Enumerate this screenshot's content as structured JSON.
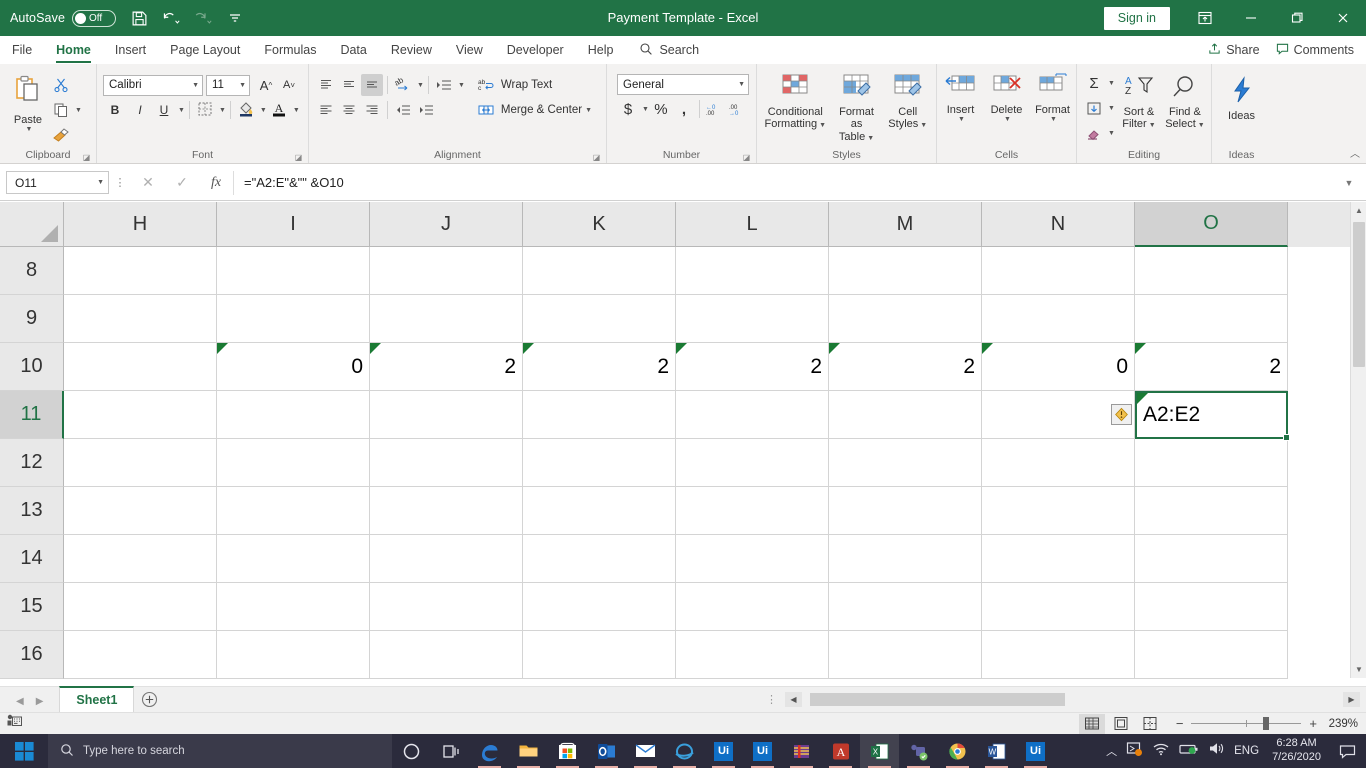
{
  "titlebar": {
    "autosave_label": "AutoSave",
    "autosave_state": "Off",
    "title": "Payment Template  -  Excel",
    "signin_label": "Sign in",
    "qat": [
      {
        "name": "save-icon",
        "label": "Save"
      },
      {
        "name": "undo-icon",
        "label": "Undo"
      },
      {
        "name": "redo-icon",
        "label": "Redo"
      },
      {
        "name": "customize-quick-access-toolbar-icon",
        "label": "Customize Quick Access Toolbar"
      }
    ],
    "window_buttons": [
      {
        "name": "ribbon-display-options-icon",
        "label": "Ribbon Display Options"
      },
      {
        "name": "minimize-icon",
        "label": "Minimize"
      },
      {
        "name": "restore-icon",
        "label": "Restore Down"
      },
      {
        "name": "close-icon",
        "label": "Close"
      }
    ],
    "accent_color": "#217346"
  },
  "tabs": [
    {
      "label": "File",
      "active": false
    },
    {
      "label": "Home",
      "active": true
    },
    {
      "label": "Insert",
      "active": false
    },
    {
      "label": "Page Layout",
      "active": false
    },
    {
      "label": "Formulas",
      "active": false
    },
    {
      "label": "Data",
      "active": false
    },
    {
      "label": "Review",
      "active": false
    },
    {
      "label": "View",
      "active": false
    },
    {
      "label": "Developer",
      "active": false
    },
    {
      "label": "Help",
      "active": false
    }
  ],
  "search": {
    "label": "Search"
  },
  "tabstrip_right": [
    {
      "label": "Share",
      "icon": "share-icon"
    },
    {
      "label": "Comments",
      "icon": "comments-icon"
    }
  ],
  "ribbon": {
    "clipboard": {
      "group_label": "Clipboard",
      "paste_label": "Paste",
      "cut_label": "Cut",
      "copy_label": "Copy",
      "format_painter_label": "Format Painter"
    },
    "font": {
      "group_label": "Font",
      "font_name": "Calibri",
      "font_size": "11",
      "grow_label": "A",
      "shrink_label": "A",
      "bold_label": "B",
      "italic_label": "I",
      "underline_label": "U",
      "borders_label": "Borders",
      "fill_color_label": "Fill Color",
      "font_color_label": "Font Color"
    },
    "alignment": {
      "group_label": "Alignment",
      "wrap_text_label": "Wrap Text",
      "merge_center_label": "Merge & Center",
      "orientation_label": "Orientation",
      "indent_label": "Indent"
    },
    "number": {
      "group_label": "Number",
      "format": "General",
      "currency_label": "$",
      "percent_label": "%",
      "comma_label": ",",
      "increase_decimal_label": "Increase Decimal",
      "decrease_decimal_label": "Decrease Decimal"
    },
    "styles": {
      "group_label": "Styles",
      "items": [
        {
          "line1": "Conditional",
          "line2": "Formatting"
        },
        {
          "line1": "Format as",
          "line2": "Table"
        },
        {
          "line1": "Cell",
          "line2": "Styles"
        }
      ]
    },
    "cells": {
      "group_label": "Cells",
      "items": [
        {
          "label": "Insert"
        },
        {
          "label": "Delete"
        },
        {
          "label": "Format"
        }
      ]
    },
    "editing": {
      "group_label": "Editing",
      "autosum_label": "AutoSum",
      "fill_label": "Fill",
      "clear_label": "Clear",
      "items": [
        {
          "line1": "Sort &",
          "line2": "Filter"
        },
        {
          "line1": "Find &",
          "line2": "Select"
        }
      ]
    },
    "ideas": {
      "group_label": "Ideas",
      "ideas_label": "Ideas"
    }
  },
  "formula_bar": {
    "name_box": "O11",
    "formula": "=\"A2:E\"&\"\" &O10",
    "cancel_label": "Cancel",
    "enter_label": "Enter",
    "fx_label": "fx"
  },
  "grid": {
    "columns": [
      "H",
      "I",
      "J",
      "K",
      "L",
      "M",
      "N",
      "O"
    ],
    "active_column": "O",
    "rows": [
      "8",
      "9",
      "10",
      "11",
      "12",
      "13",
      "14",
      "15",
      "16"
    ],
    "active_row": "11",
    "row_data": {
      "8": [
        "",
        "",
        "",
        "",
        "",
        "",
        "",
        ""
      ],
      "9": [
        "",
        "",
        "",
        "",
        "",
        "",
        "",
        ""
      ],
      "10": [
        "",
        "0",
        "2",
        "2",
        "2",
        "2",
        "0",
        "2"
      ],
      "11": [
        "",
        "",
        "",
        "",
        "",
        "",
        "",
        "A2:E2"
      ],
      "12": [
        "",
        "",
        "",
        "",
        "",
        "",
        "",
        ""
      ],
      "13": [
        "",
        "",
        "",
        "",
        "",
        "",
        "",
        ""
      ],
      "14": [
        "",
        "",
        "",
        "",
        "",
        "",
        "",
        ""
      ],
      "15": [
        "",
        "",
        "",
        "",
        "",
        "",
        "",
        ""
      ],
      "16": [
        "",
        "",
        "",
        "",
        "",
        "",
        "",
        ""
      ]
    },
    "selected_cell": "O11",
    "selected_cell_value": "A2:E2",
    "error_triangle_cells": [
      "I10",
      "J10",
      "K10",
      "L10",
      "M10",
      "N10",
      "O10",
      "O11"
    ],
    "smart_tag": {
      "cell": "O11",
      "name": "error-checking-warning-icon"
    }
  },
  "sheet_tabs": {
    "tabs": [
      {
        "label": "Sheet1",
        "active": true
      }
    ],
    "add_sheet_label": "+",
    "prev_label": "◀",
    "next_label": "▶"
  },
  "status_bar": {
    "views": [
      {
        "name": "normal-view-button",
        "label": "Normal",
        "active": true
      },
      {
        "name": "page-layout-view-button",
        "label": "Page Layout",
        "active": false
      },
      {
        "name": "page-break-preview-button",
        "label": "Page Break Preview",
        "active": false
      }
    ],
    "zoom_out_label": "−",
    "zoom_in_label": "+",
    "zoom_level": "239%"
  },
  "taskbar": {
    "search_placeholder": "Type here to search",
    "apps": [
      {
        "name": "cortana-icon",
        "label": "Cortana"
      },
      {
        "name": "task-view-icon",
        "label": "Task View"
      },
      {
        "name": "edge-icon",
        "label": "Microsoft Edge"
      },
      {
        "name": "file-explorer-icon",
        "label": "File Explorer"
      },
      {
        "name": "microsoft-store-icon",
        "label": "Microsoft Store"
      },
      {
        "name": "outlook-icon",
        "label": "Outlook"
      },
      {
        "name": "mail-icon",
        "label": "Mail"
      },
      {
        "name": "internet-explorer-icon",
        "label": "Internet Explorer"
      },
      {
        "name": "uipath-studio-icon",
        "label": "Ui"
      },
      {
        "name": "uipath-icon",
        "label": "Ui"
      },
      {
        "name": "winrar-icon",
        "label": "WinRAR"
      },
      {
        "name": "adobe-reader-icon",
        "label": "Adobe Reader"
      },
      {
        "name": "excel-icon",
        "label": "Excel"
      },
      {
        "name": "teams-icon",
        "label": "Microsoft Teams"
      },
      {
        "name": "chrome-icon",
        "label": "Google Chrome"
      },
      {
        "name": "word-icon",
        "label": "Word"
      },
      {
        "name": "uipath-assistant-icon",
        "label": "Ui"
      }
    ],
    "tray": {
      "language": "ENG",
      "time": "6:28 AM",
      "date": "7/26/2020"
    }
  }
}
